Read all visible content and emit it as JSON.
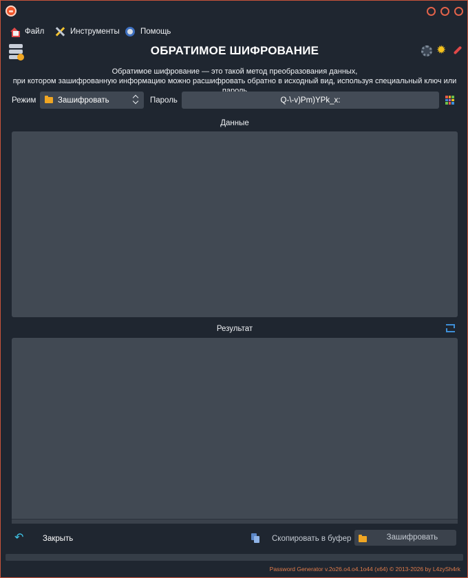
{
  "menu": {
    "file": "Файл",
    "tools": "Инструменты",
    "help": "Помощь"
  },
  "header": {
    "title": "ОБРАТИМОЕ ШИФРОВАНИЕ"
  },
  "description": {
    "line1": "Обратимое шифрование — это такой метод преобразования данных,",
    "line2": "при котором зашифрованную информацию можно расшифровать обратно в исходный вид, используя специальный ключ или пароль"
  },
  "form": {
    "mode_label": "Режим",
    "mode_value": "Зашифровать",
    "password_label": "Пароль",
    "password_value": "Q-\\-v)Pm)YPk_x:"
  },
  "sections": {
    "data_label": "Данные",
    "result_label": "Результат"
  },
  "actions": {
    "close": "Закрыть",
    "copy": "Скопировать в буфер",
    "encrypt": "Зашифровать"
  },
  "footer": {
    "text": "Password Generator v.2o26.o4.o4.1o44 (x64) © 2013-2026 by L4zySh4rk"
  },
  "colors": {
    "window_bg": "#1f2630",
    "field_bg": "#414953",
    "accent_border": "#c9543a",
    "footer_text": "#e37c4a",
    "key_orange": "#f0a623"
  }
}
